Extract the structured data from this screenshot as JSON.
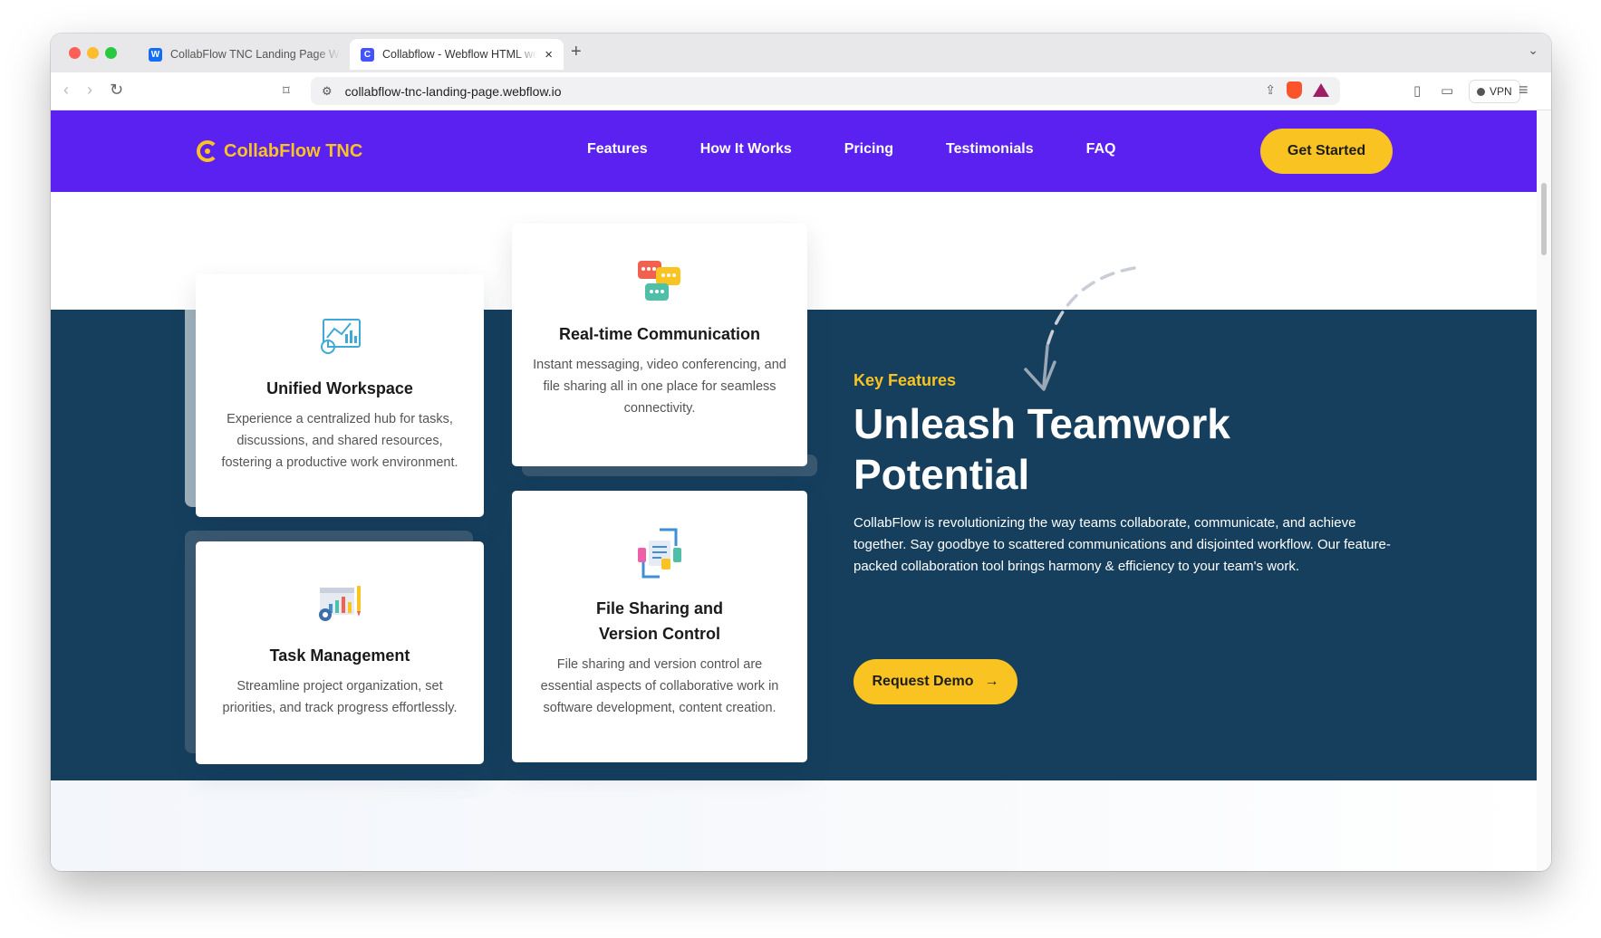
{
  "browser": {
    "tabs": [
      {
        "title": "CollabFlow TNC Landing Page Webflow",
        "favicon": "webflow-icon",
        "active": false
      },
      {
        "title": "Collabflow - Webflow HTML website",
        "favicon": "collabflow-icon",
        "active": true
      }
    ],
    "url": "collabflow-tnc-landing-page.webflow.io",
    "vpn_label": "VPN",
    "new_tab_symbol": "+",
    "close_symbol": "×"
  },
  "site": {
    "brand": "CollabFlow TNC",
    "nav": [
      "Features",
      "How It Works",
      "Pricing",
      "Testimonials",
      "FAQ"
    ],
    "cta": "Get Started",
    "section": {
      "eyebrow": "Key Features",
      "headline": "Unleash Teamwork Potential",
      "body": "CollabFlow is revolutionizing the way teams collaborate, communicate, and achieve together. Say goodbye to scattered communications and disjointed workflow. Our feature-packed collaboration tool brings harmony & efficiency to your team's work.",
      "demo_button": "Request Demo",
      "demo_arrow": "→"
    },
    "cards": [
      {
        "title": "Unified Workspace",
        "description": "Experience a centralized hub for tasks, discussions, and shared resources, fostering a productive work environment.",
        "icon": "analytics-icon"
      },
      {
        "title": "Real-time Communication",
        "description": "Instant messaging, video conferencing, and file sharing all in one place for seamless connectivity.",
        "icon": "chat-bubbles-icon"
      },
      {
        "title": "Task Management",
        "description": "Streamline project organization, set priorities, and track progress effortlessly.",
        "icon": "task-chart-icon"
      },
      {
        "title": "File Sharing and Version Control",
        "description": "File sharing and version control are essential aspects of collaborative work in software development, content creation.",
        "icon": "file-sync-icon"
      }
    ],
    "colors": {
      "nav_bg": "#5b21f0",
      "accent": "#f9c322",
      "band_bg": "#163f5e"
    }
  }
}
